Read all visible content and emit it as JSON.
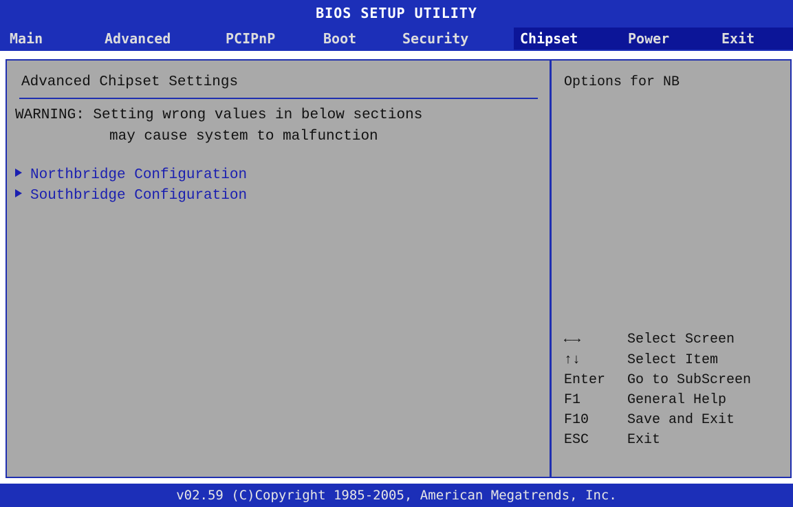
{
  "header": {
    "title": "BIOS SETUP UTILITY"
  },
  "menu": {
    "items": [
      {
        "label": "Main"
      },
      {
        "label": "Advanced"
      },
      {
        "label": "PCIPnP"
      },
      {
        "label": "Boot"
      },
      {
        "label": "Security"
      },
      {
        "label": "Chipset",
        "selected": true
      },
      {
        "label": "Power"
      },
      {
        "label": "Exit"
      }
    ]
  },
  "main": {
    "section_title": "Advanced Chipset Settings",
    "warning_line1": "WARNING: Setting wrong values in below sections",
    "warning_line2": "may cause system to malfunction",
    "submenus": [
      {
        "label": "Northbridge Configuration"
      },
      {
        "label": "Southbridge Configuration"
      }
    ]
  },
  "help": {
    "text": "Options for NB",
    "keys": [
      {
        "key": "←→",
        "action": "Select Screen"
      },
      {
        "key": "↑↓",
        "action": "Select Item"
      },
      {
        "key": "Enter",
        "action": "Go to SubScreen"
      },
      {
        "key": "F1",
        "action": "General Help"
      },
      {
        "key": "F10",
        "action": "Save and Exit"
      },
      {
        "key": "ESC",
        "action": "Exit"
      }
    ]
  },
  "footer": {
    "text": "v02.59 (C)Copyright 1985-2005, American Megatrends, Inc."
  },
  "colors": {
    "bar_blue": "#1c2fb8",
    "panel_gray": "#a9a9a9",
    "link_blue": "#1a1fb0"
  }
}
